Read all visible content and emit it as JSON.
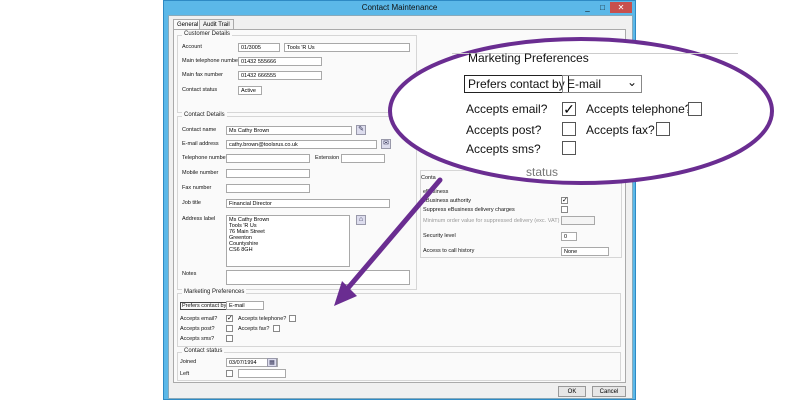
{
  "window": {
    "title": "Contact Maintenance",
    "minimize": "_",
    "restore": "□",
    "close": "✕"
  },
  "tabs": [
    {
      "label": "General"
    },
    {
      "label": "Audit Trail"
    }
  ],
  "customer": {
    "title": "Customer Details",
    "account_label": "Account",
    "account_code": "01/3005",
    "account_name": "Tools 'R Us",
    "main_phone_label": "Main telephone number",
    "main_phone": "01432 555666",
    "main_fax_label": "Main fax number",
    "main_fax": "01432 666555",
    "status_label": "Contact status",
    "status": "Active"
  },
  "contact": {
    "title": "Contact Details",
    "name_label": "Contact name",
    "name": "Ms Cathy Brown",
    "email_label": "E-mail address",
    "email": "cathy.brown@toolsrus.co.uk",
    "phone_label": "Telephone number",
    "phone": "",
    "extension_label": "Extension",
    "extension": "",
    "mobile_label": "Mobile number",
    "mobile": "",
    "fax_label": "Fax number",
    "fax": "",
    "job_label": "Job title",
    "job": "Financial Director",
    "address_label": "Address label",
    "address": "Ms Cathy Brown\nTools 'R Us\n76 Main Street\nGreenton\nCountyshire\nCS6 8GH",
    "notes_label": "Notes",
    "notes": ""
  },
  "right_panel": {
    "contact_group_label": "Conta",
    "ebusiness_title": "eBusiness",
    "ebusiness_authority": "eBusiness authority",
    "suppress_charges": "Suppress eBusiness delivery charges",
    "min_order": "Minimum order value for suppressed delivery (exc. VAT)",
    "security_label": "Security level",
    "security": "0",
    "call_history_label": "Access to call history",
    "call_history": "None"
  },
  "marketing": {
    "title": "Marketing Preferences",
    "prefers_label": "Prefers contact by",
    "prefers": "E-mail",
    "email_label": "Accepts email?",
    "email": true,
    "telephone_label": "Accepts telephone?",
    "telephone": false,
    "post_label": "Accepts post?",
    "post": false,
    "fax_label": "Accepts fax?",
    "fax": false,
    "sms_label": "Accepts sms?",
    "sms": false
  },
  "contact_status": {
    "title": "Contact status",
    "joined_label": "Joined",
    "joined": "03/07/1994",
    "left_label": "Left",
    "left": ""
  },
  "buttons": {
    "ok": "OK",
    "cancel": "Cancel"
  },
  "callout": {
    "partial_title": "status",
    "dropdown_arrow": "⌄"
  },
  "glyphs": {
    "check": "✓",
    "pencil": "✎",
    "mail": "✉",
    "address": "⌂",
    "calendar": "▦"
  },
  "colors": {
    "annotation": "#6a2d91",
    "titlebar": "#5bb8e8",
    "close": "#c7504d"
  }
}
